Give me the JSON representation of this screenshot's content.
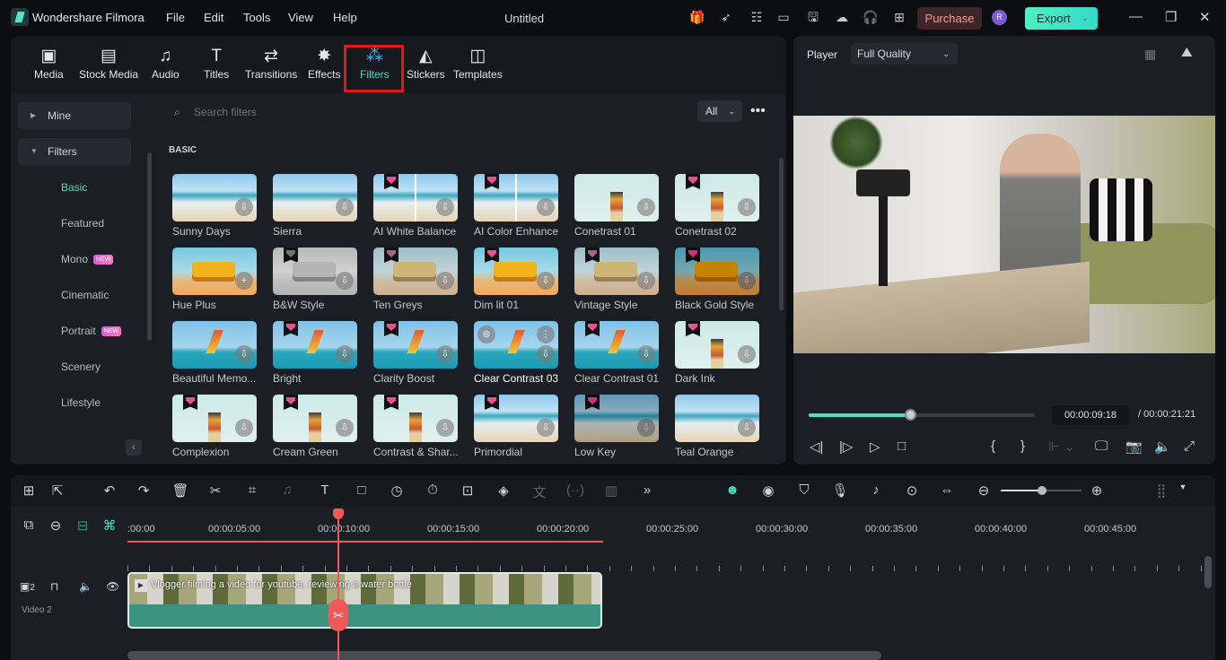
{
  "app": {
    "name": "Wondershare Filmora",
    "doc_title": "Untitled",
    "menu": [
      "File",
      "Edit",
      "Tools",
      "View",
      "Help"
    ],
    "purchase": "Purchase",
    "avatar": "R",
    "export": "Export",
    "accent": "#4be0c4",
    "highlight": "#e3151f"
  },
  "tabs": [
    {
      "label": "Media",
      "icon": "media-icon"
    },
    {
      "label": "Stock Media",
      "icon": "stock-media-icon"
    },
    {
      "label": "Audio",
      "icon": "music-note-icon"
    },
    {
      "label": "Titles",
      "icon": "text-t-icon"
    },
    {
      "label": "Transitions",
      "icon": "transitions-icon"
    },
    {
      "label": "Effects",
      "icon": "sparkle-icon"
    },
    {
      "label": "Filters",
      "icon": "filters-icon",
      "active": true
    },
    {
      "label": "Stickers",
      "icon": "stickers-icon"
    },
    {
      "label": "Templates",
      "icon": "templates-icon"
    }
  ],
  "sidebar": {
    "groups": [
      {
        "label": "Mine",
        "expanded": false
      },
      {
        "label": "Filters",
        "expanded": true
      }
    ],
    "items": [
      {
        "label": "Basic",
        "active": true
      },
      {
        "label": "Featured"
      },
      {
        "label": "Mono",
        "badge": "NEW"
      },
      {
        "label": "Cinematic"
      },
      {
        "label": "Portrait",
        "badge": "NEW"
      },
      {
        "label": "Scenery"
      },
      {
        "label": "Lifestyle"
      }
    ]
  },
  "search": {
    "placeholder": "Search filters",
    "filter": "All"
  },
  "section": "BASIC",
  "filters": [
    {
      "name": "Sunny Days",
      "thumb": "beach",
      "premium": false
    },
    {
      "name": "Sierra",
      "thumb": "beach",
      "premium": false
    },
    {
      "name": "AI White Balance",
      "thumb": "beach split",
      "premium": true
    },
    {
      "name": "AI Color Enhance",
      "thumb": "beach split",
      "premium": true
    },
    {
      "name": "Conetrast 01",
      "thumb": "lh",
      "premium": false
    },
    {
      "name": "Conetrast 02",
      "thumb": "lh",
      "premium": true
    },
    {
      "name": "Hue Plus",
      "thumb": "van",
      "premium": false,
      "action": "add"
    },
    {
      "name": "B&W Style",
      "thumb": "van gray",
      "premium": true
    },
    {
      "name": "Ten Greys",
      "thumb": "van half",
      "premium": true
    },
    {
      "name": "Dim lit 01",
      "thumb": "van",
      "premium": true
    },
    {
      "name": "Vintage Style",
      "thumb": "van half",
      "premium": true
    },
    {
      "name": "Black Gold Style",
      "thumb": "van dark",
      "premium": true
    },
    {
      "name": "Beautiful Memo...",
      "thumb": "kite",
      "premium": false
    },
    {
      "name": "Bright",
      "thumb": "kite",
      "premium": true
    },
    {
      "name": "Clarity Boost",
      "thumb": "kite",
      "premium": true
    },
    {
      "name": "Clear Contrast 03",
      "thumb": "kite",
      "premium": false,
      "hover": true
    },
    {
      "name": "Clear Contrast 01",
      "thumb": "kite",
      "premium": true
    },
    {
      "name": "Dark Ink",
      "thumb": "lh",
      "premium": true
    },
    {
      "name": "Complexion",
      "thumb": "lh",
      "premium": true
    },
    {
      "name": "Cream Green",
      "thumb": "lh",
      "premium": true
    },
    {
      "name": "Contrast & Shar...",
      "thumb": "lh",
      "premium": true
    },
    {
      "name": "Primordial",
      "thumb": "beach",
      "premium": true
    },
    {
      "name": "Low Key",
      "thumb": "beach dark",
      "premium": true
    },
    {
      "name": "Teal Orange",
      "thumb": "beach",
      "premium": false
    }
  ],
  "player": {
    "label": "Player",
    "quality": "Full Quality",
    "current": "00:00:09:18",
    "total": "/ 00:00:21:21",
    "progress": 0.45
  },
  "timeline": {
    "ruler": [
      ":00:00",
      "00:00:05:00",
      "00:00:10:00",
      "00:00:15:00",
      "00:00:20:00",
      "00:00:25:00",
      "00:00:30:00",
      "00:00:35:00",
      "00:00:40:00",
      "00:00:45:00"
    ],
    "track_label": "Video 2",
    "track_num": "2",
    "clip_title": "Vlogger filming a video for youtube, reviewing a water bottle",
    "zoom": 0.5
  }
}
